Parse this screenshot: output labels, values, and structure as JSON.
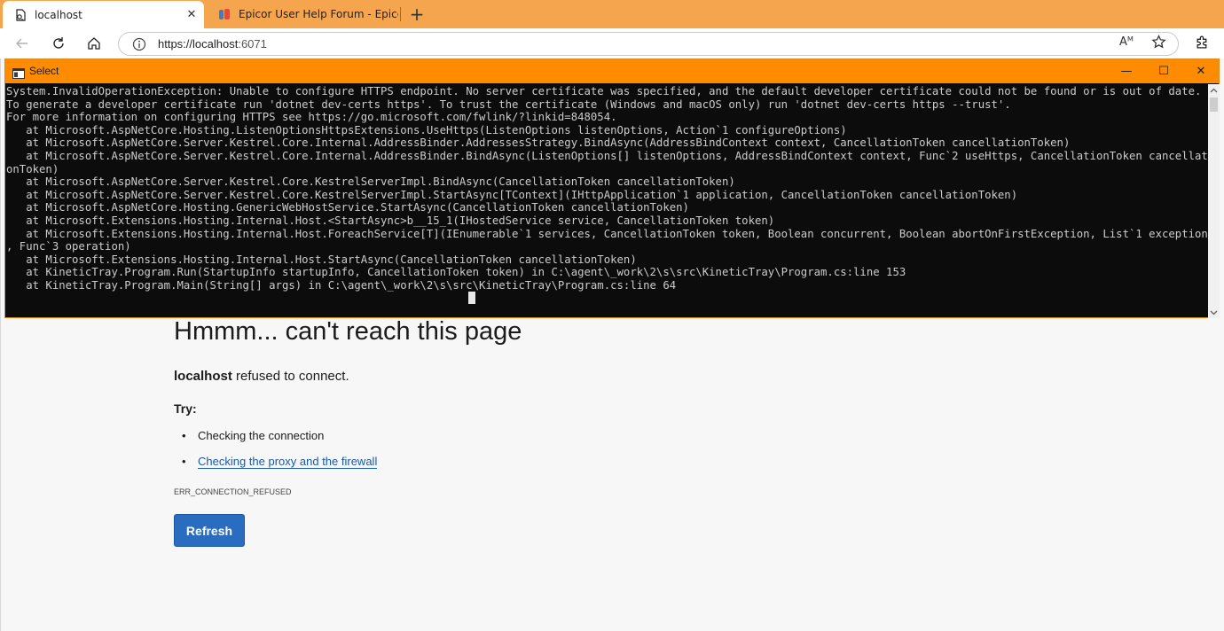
{
  "browser": {
    "tabs": [
      {
        "title": "localhost",
        "close": "✕"
      },
      {
        "title": "Epicor User Help Forum - Epicor U"
      }
    ],
    "new_tab": "+",
    "address": {
      "url_main": "https://localhost",
      "url_port": ":6071"
    },
    "read_aloud": "Aᴹ"
  },
  "console": {
    "title": "Select",
    "controls": {
      "minimize": "—",
      "maximize": "☐",
      "close": "✕"
    },
    "lines": [
      "System.InvalidOperationException: Unable to configure HTTPS endpoint. No server certificate was specified, and the default developer certificate could not be found or is out of date.",
      "To generate a developer certificate run 'dotnet dev-certs https'. To trust the certificate (Windows and macOS only) run 'dotnet dev-certs https --trust'.",
      "For more information on configuring HTTPS see https://go.microsoft.com/fwlink/?linkid=848054.",
      "   at Microsoft.AspNetCore.Hosting.ListenOptionsHttpsExtensions.UseHttps(ListenOptions listenOptions, Action`1 configureOptions)",
      "   at Microsoft.AspNetCore.Server.Kestrel.Core.Internal.AddressBinder.AddressesStrategy.BindAsync(AddressBindContext context, CancellationToken cancellationToken)",
      "   at Microsoft.AspNetCore.Server.Kestrel.Core.Internal.AddressBinder.BindAsync(ListenOptions[] listenOptions, AddressBindContext context, Func`2 useHttps, CancellationToken cancellati",
      "onToken)",
      "   at Microsoft.AspNetCore.Server.Kestrel.Core.KestrelServerImpl.BindAsync(CancellationToken cancellationToken)",
      "   at Microsoft.AspNetCore.Server.Kestrel.Core.KestrelServerImpl.StartAsync[TContext](IHttpApplication`1 application, CancellationToken cancellationToken)",
      "   at Microsoft.AspNetCore.Hosting.GenericWebHostService.StartAsync(CancellationToken cancellationToken)",
      "   at Microsoft.Extensions.Hosting.Internal.Host.<StartAsync>b__15_1(IHostedService service, CancellationToken token)",
      "   at Microsoft.Extensions.Hosting.Internal.Host.ForeachService[T](IEnumerable`1 services, CancellationToken token, Boolean concurrent, Boolean abortOnFirstException, List`1 exceptions",
      ", Func`3 operation)",
      "   at Microsoft.Extensions.Hosting.Internal.Host.StartAsync(CancellationToken cancellationToken)",
      "   at KineticTray.Program.Run(StartupInfo startupInfo, CancellationToken token) in C:\\agent\\_work\\2\\s\\src\\KineticTray\\Program.cs:line 153",
      "   at KineticTray.Program.Main(String[] args) in C:\\agent\\_work\\2\\s\\src\\KineticTray\\Program.cs:line 64"
    ]
  },
  "error_page": {
    "title": "Hmmm... can't reach this page",
    "host": "localhost",
    "message": " refused to connect.",
    "try_label": "Try:",
    "suggestions": [
      "Checking the connection",
      "Checking the proxy and the firewall"
    ],
    "bullet": "•",
    "error_code": "ERR_CONNECTION_REFUSED",
    "refresh_label": "Refresh"
  }
}
